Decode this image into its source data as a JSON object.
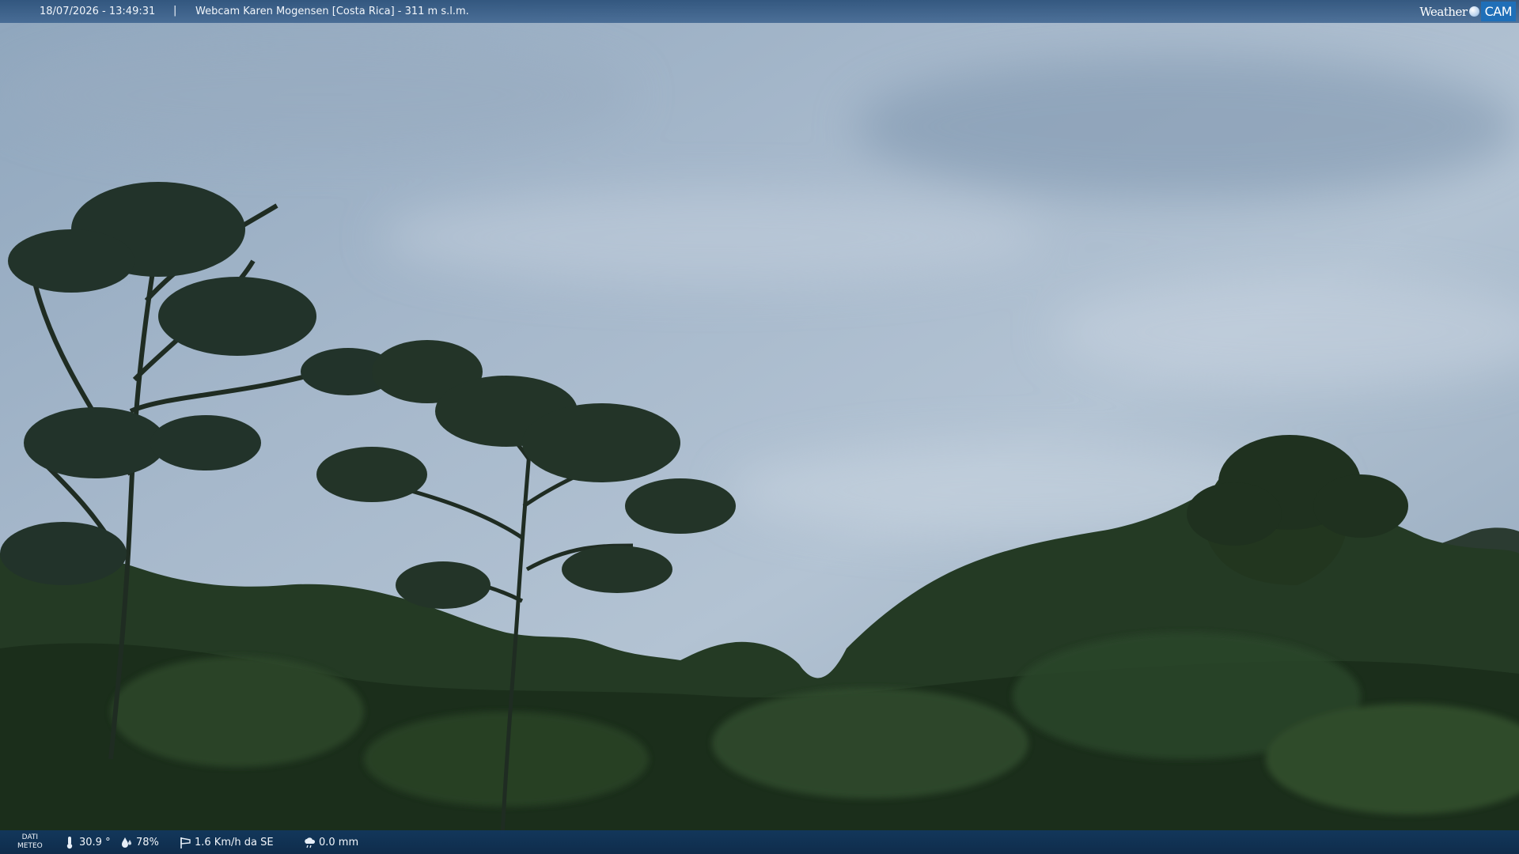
{
  "overlay": {
    "timestamp": "18/07/2026 - 13:49:31",
    "separator": "|",
    "title": "Webcam Karen Mogensen [Costa Rica] - 311 m s.l.m."
  },
  "logo": {
    "weather": "Weather",
    "cam": "CAM"
  },
  "weather": {
    "label_line1": "DATI",
    "label_line2": "METEO",
    "temperature": "30.9 °",
    "humidity": "78%",
    "wind": "1.6 Km/h da SE",
    "rain": "0.0 mm"
  },
  "colors": {
    "bar": "#2b5b8f",
    "brand": "#1f6fb8",
    "forest": "#1c2e1d",
    "sky": "#a9bccf"
  }
}
